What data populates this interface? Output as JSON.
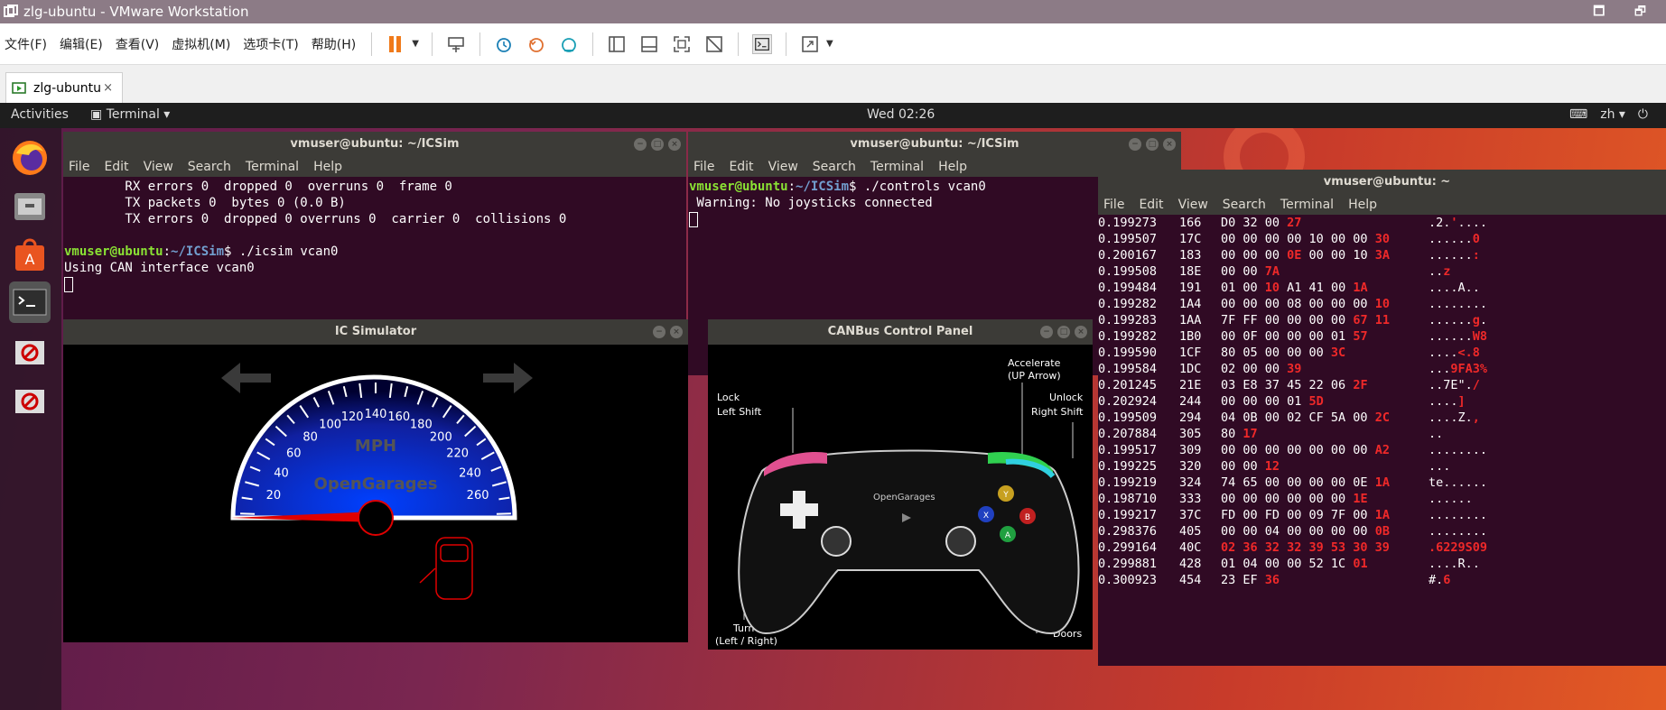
{
  "host": {
    "title": "zlg-ubuntu - VMware Workstation",
    "menus": [
      "文件(F)",
      "编辑(E)",
      "查看(V)",
      "虚拟机(M)",
      "选项卡(T)",
      "帮助(H)"
    ],
    "tab_label": "zlg-ubuntu",
    "tab_close": "×",
    "window_buttons": "🗖 🗗"
  },
  "guest": {
    "activities": "Activities",
    "terminal_menu": "Terminal ▾",
    "clock": "Wed 02:26",
    "keyboard": "⌨",
    "lang": "zh ▾",
    "power": "⏻"
  },
  "colors": {
    "accent_red": "#ef2929",
    "prompt_green": "#8ae234",
    "prompt_blue": "#729fcf",
    "terminal_bg": "#300a24"
  },
  "term1": {
    "title": "vmuser@ubuntu: ~/ICSim",
    "menu": [
      "File",
      "Edit",
      "View",
      "Search",
      "Terminal",
      "Help"
    ],
    "lines": [
      "        RX errors 0  dropped 0  overruns 0  frame 0",
      "        TX packets 0  bytes 0 (0.0 B)",
      "        TX errors 0  dropped 0 overruns 0  carrier 0  collisions 0",
      ""
    ],
    "prompt_user": "vmuser@ubuntu",
    "prompt_path": "~/ICSim",
    "command": "$ ./icsim vcan0",
    "output": "Using CAN interface vcan0"
  },
  "term2": {
    "title": "vmuser@ubuntu: ~/ICSim",
    "menu": [
      "File",
      "Edit",
      "View",
      "Search",
      "Terminal",
      "Help"
    ],
    "prompt_user": "vmuser@ubuntu",
    "prompt_path": "~/ICSim",
    "command": "$ ./controls vcan0",
    "output": " Warning: No joysticks connected"
  },
  "icsim": {
    "title": "IC Simulator",
    "mph": "MPH",
    "brand": "OpenGarages",
    "speed_ticks": [
      "20",
      "40",
      "60",
      "80",
      "100",
      "120",
      "140",
      "160",
      "180",
      "200",
      "220",
      "240",
      "260"
    ]
  },
  "controls": {
    "title": "CANBus Control Panel",
    "labels": {
      "lock": "Lock",
      "lock_key": "Left Shift",
      "accel": "Accelerate",
      "accel_key": "(UP Arrow)",
      "unlock": "Unlock",
      "unlock_key": "Right Shift",
      "turn": "Turn",
      "turn_key": "(Left / Right)",
      "doors": "Doors",
      "brand": "OpenGarages",
      "btn_y": "Y",
      "btn_x": "X",
      "btn_b": "B",
      "btn_a": "A"
    }
  },
  "candump": {
    "title": "vmuser@ubuntu: ~",
    "menu": [
      "File",
      "Edit",
      "View",
      "Search",
      "Terminal",
      "Help"
    ],
    "rows": [
      {
        "t": "0.199273",
        "id": "166",
        "d": [
          [
            "D0 32 00 ",
            0
          ],
          [
            "27",
            1
          ]
        ],
        "a": [
          [
            ".2.",
            0
          ],
          [
            "'",
            1
          ],
          [
            "....",
            0
          ]
        ]
      },
      {
        "t": "0.199507",
        "id": "17C",
        "d": [
          [
            "00 00 00 00 10 00 00 ",
            0
          ],
          [
            "30",
            1
          ]
        ],
        "a": [
          [
            "......",
            0
          ],
          [
            "0",
            1
          ]
        ]
      },
      {
        "t": "0.200167",
        "id": "183",
        "d": [
          [
            "00 00 00 ",
            0
          ],
          [
            "0E",
            1
          ],
          [
            " 00 00 10 ",
            0
          ],
          [
            "3A",
            1
          ]
        ],
        "a": [
          [
            "......",
            0
          ],
          [
            ":",
            1
          ]
        ]
      },
      {
        "t": "0.199508",
        "id": "18E",
        "d": [
          [
            "00 00 ",
            0
          ],
          [
            "7A",
            1
          ]
        ],
        "a": [
          [
            "..",
            0
          ],
          [
            "z",
            1
          ]
        ]
      },
      {
        "t": "0.199484",
        "id": "191",
        "d": [
          [
            "01 00 ",
            0
          ],
          [
            "10",
            1
          ],
          [
            " A1 41 00 ",
            0
          ],
          [
            "1A",
            1
          ]
        ],
        "a": [
          [
            "....A..",
            0
          ]
        ]
      },
      {
        "t": "0.199282",
        "id": "1A4",
        "d": [
          [
            "00 00 00 08 00 00 00 ",
            0
          ],
          [
            "10",
            1
          ]
        ],
        "a": [
          [
            "........",
            0
          ]
        ]
      },
      {
        "t": "0.199283",
        "id": "1AA",
        "d": [
          [
            "7F FF 00 00 00 00 ",
            0
          ],
          [
            "67 11",
            1
          ]
        ],
        "a": [
          [
            "......",
            0
          ],
          [
            "g",
            1
          ],
          [
            ".",
            0
          ]
        ]
      },
      {
        "t": "0.199282",
        "id": "1B0",
        "d": [
          [
            "00 0F 00 00 00 01 ",
            0
          ],
          [
            "57",
            1
          ]
        ],
        "a": [
          [
            "......",
            0
          ],
          [
            "W8",
            1
          ]
        ]
      },
      {
        "t": "0.199590",
        "id": "1CF",
        "d": [
          [
            "80 05 00 00 00 ",
            0
          ],
          [
            "3C",
            1
          ]
        ],
        "a": [
          [
            "....",
            0
          ],
          [
            "<.8",
            1
          ]
        ]
      },
      {
        "t": "0.199584",
        "id": "1DC",
        "d": [
          [
            "02 00 00 ",
            0
          ],
          [
            "39",
            1
          ]
        ],
        "a": [
          [
            "...",
            0
          ],
          [
            "9FA3%",
            1
          ]
        ]
      },
      {
        "t": "0.201245",
        "id": "21E",
        "d": [
          [
            "03 E8 37 45 22 06 ",
            0
          ],
          [
            "2F",
            1
          ]
        ],
        "a": [
          [
            "..7E\".",
            0
          ],
          [
            "/",
            1
          ]
        ]
      },
      {
        "t": "0.202924",
        "id": "244",
        "d": [
          [
            "00 00 00 01 ",
            0
          ],
          [
            "5D",
            1
          ]
        ],
        "a": [
          [
            "....",
            0
          ],
          [
            "]",
            1
          ]
        ]
      },
      {
        "t": "0.199509",
        "id": "294",
        "d": [
          [
            "04 0B 00 02 CF 5A 00 ",
            0
          ],
          [
            "2C",
            1
          ]
        ],
        "a": [
          [
            "....Z.",
            0
          ],
          [
            ",",
            1
          ]
        ]
      },
      {
        "t": "0.207884",
        "id": "305",
        "d": [
          [
            "80 ",
            0
          ],
          [
            "17",
            1
          ]
        ],
        "a": [
          [
            "..",
            0
          ]
        ]
      },
      {
        "t": "0.199517",
        "id": "309",
        "d": [
          [
            "00 00 00 00 00 00 00 ",
            0
          ],
          [
            "A2",
            1
          ]
        ],
        "a": [
          [
            "........",
            0
          ]
        ]
      },
      {
        "t": "0.199225",
        "id": "320",
        "d": [
          [
            "00 00 ",
            0
          ],
          [
            "12",
            1
          ]
        ],
        "a": [
          [
            "...",
            0
          ]
        ]
      },
      {
        "t": "0.199219",
        "id": "324",
        "d": [
          [
            "74 65 00 00 00 00 0E ",
            0
          ],
          [
            "1A",
            1
          ]
        ],
        "a": [
          [
            "te......",
            0
          ]
        ]
      },
      {
        "t": "0.198710",
        "id": "333",
        "d": [
          [
            "00 00 00 00 00 00 ",
            0
          ],
          [
            "1E",
            1
          ]
        ],
        "a": [
          [
            "......",
            0
          ]
        ]
      },
      {
        "t": "0.199217",
        "id": "37C",
        "d": [
          [
            "FD 00 FD 00 09 7F 00 ",
            0
          ],
          [
            "1A",
            1
          ]
        ],
        "a": [
          [
            "........",
            0
          ]
        ]
      },
      {
        "t": "0.298376",
        "id": "405",
        "d": [
          [
            "00 00 04 00 00 00 00 ",
            0
          ],
          [
            "0B",
            1
          ]
        ],
        "a": [
          [
            "........",
            0
          ]
        ]
      },
      {
        "t": "0.299164",
        "id": "40C",
        "d": [
          [
            "02 36 32 32 39 53 30 39",
            1
          ]
        ],
        "a": [
          [
            ".6229S09",
            1
          ]
        ]
      },
      {
        "t": "0.299881",
        "id": "428",
        "d": [
          [
            "01 04 00 00 52 1C ",
            0
          ],
          [
            "01",
            1
          ]
        ],
        "a": [
          [
            "....R..",
            0
          ]
        ]
      },
      {
        "t": "0.300923",
        "id": "454",
        "d": [
          [
            "23 EF ",
            0
          ],
          [
            "36",
            1
          ]
        ],
        "a": [
          [
            "#.",
            0
          ],
          [
            "6",
            1
          ]
        ]
      }
    ]
  }
}
